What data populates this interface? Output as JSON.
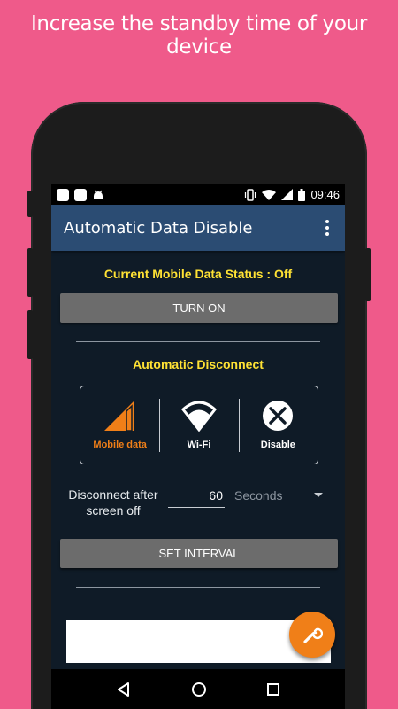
{
  "promo": {
    "headline": "Increase the standby time of your device"
  },
  "statusbar": {
    "time": "09:46"
  },
  "appbar": {
    "title": "Automatic Data Disable"
  },
  "main": {
    "status_text": "Current Mobile Data Status : Off",
    "turn_on_label": "TURN ON",
    "section_title": "Automatic Disconnect",
    "modes": [
      {
        "label": "Mobile data",
        "icon": "signal-icon",
        "selected": true
      },
      {
        "label": "Wi-Fi",
        "icon": "wifi-icon",
        "selected": false
      },
      {
        "label": "Disable",
        "icon": "close-circle-icon",
        "selected": false
      }
    ],
    "interval_label": "Disconnect after screen off",
    "interval_value": "60",
    "interval_unit": "Seconds",
    "set_interval_label": "SET INTERVAL"
  },
  "fab": {
    "icon": "wrench-icon"
  },
  "navbar": {
    "icons": [
      "back-icon",
      "home-icon",
      "recents-icon"
    ]
  },
  "colors": {
    "background": "#ef5a8a",
    "appbar": "#2b4c73",
    "screen": "#0f1b27",
    "highlight_text": "#ffe234",
    "accent": "#f07f18",
    "button": "#6c6c6c"
  }
}
